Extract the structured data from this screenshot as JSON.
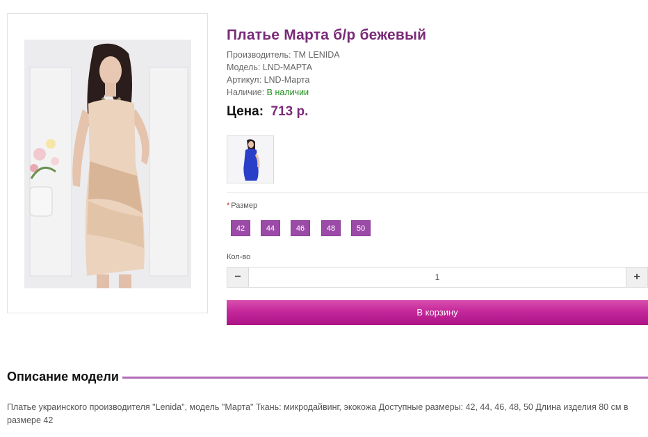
{
  "product": {
    "title": "Платье Марта б/р бежевый",
    "manufacturer_label": "Производитель:",
    "manufacturer_value": "TM LENIDA",
    "model_label": "Модель:",
    "model_value": "LND-МАРТА",
    "sku_label": "Артикул:",
    "sku_value": "LND-Марта",
    "availability_label": "Наличие:",
    "availability_value": "В наличии",
    "price_label": "Цена:",
    "price_value": "713 р."
  },
  "options": {
    "size_label": "Размер",
    "sizes": [
      "42",
      "44",
      "46",
      "48",
      "50"
    ],
    "qty_label": "Кол-во",
    "qty_value": "1",
    "qty_minus": "−",
    "qty_plus": "+"
  },
  "cart": {
    "button_label": "В корзину"
  },
  "description": {
    "heading": "Описание модели",
    "text": "Платье украинского производителя \"Lenida\", модель \"Марта\" Ткань: микродайвинг, экокожа Доступные размеры: 42, 44, 46, 48, 50 Длина изделия 80 см в размере 42"
  },
  "colors": {
    "accent": "#7a2a78",
    "size_button": "#9c4aa8",
    "cart_button": "#c4289a",
    "in_stock": "#1a8a1a"
  }
}
